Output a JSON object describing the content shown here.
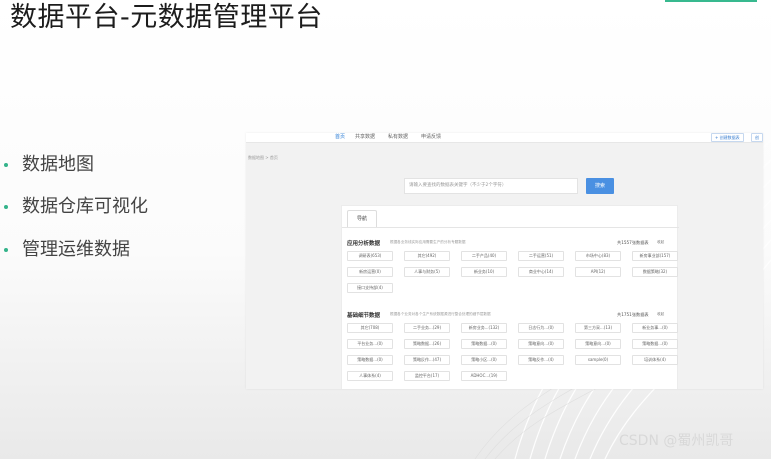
{
  "slide": {
    "title": "数据平台-元数据管理平台",
    "bullets": [
      "数据地图",
      "数据仓库可视化",
      "管理运维数据"
    ],
    "watermark": "CSDN @蜀州凯哥"
  },
  "screenshot": {
    "nav": {
      "links": [
        "首页",
        "共享数据",
        "私有数据",
        "申请反馈"
      ],
      "active_index": 0,
      "buttons": [
        "+ 创建数据表",
        "创"
      ]
    },
    "breadcrumb": "数据地图 > 首页",
    "search": {
      "placeholder": "请输入要查找的数据表关键字（不少于2个字符）",
      "button_label": "搜索"
    },
    "tab_label": "导航",
    "sections": [
      {
        "title": "应用分析数据",
        "description": "根据各业务线实际应用需要生产的分析专题数据",
        "count": "共1557张数据表",
        "toggle": "收起",
        "tags": [
          "调研表(653)",
          "其它(492)",
          "二手产品(40)",
          "二手运营(51)",
          "市场中心(83)",
          "新房事业部(157)",
          "新房运营(0)",
          "人事与财务(5)",
          "新业务(10)",
          "商业中心(14)",
          "API(12)",
          "数据策略(32)",
          "接口支持部(4)"
        ]
      },
      {
        "title": "基础细节数据",
        "description": "根据各个业务对各个生产系统数据源进行整合处理的细节层数据",
        "count": "共1751张数据表",
        "toggle": "收起",
        "tags": [
          "其它(708)",
          "二手业务...(29)",
          "新房业务...(132)",
          "日志行为...(0)",
          "第三方采...(13)",
          "新业务事...(0)",
          "平台业务...(0)",
          "策略数据...(26)",
          "策略数据...(0)",
          "策略意向...(0)",
          "策略意向...(0)",
          "策略数据...(0)",
          "策略数据...(0)",
          "策略反作...(47)",
          "策略小区...(0)",
          "策略反作...(4)",
          "sample(0)",
          "培训体系(4)",
          "人事体系(4)",
          "监控平台(17)",
          "ADHOC...(19)"
        ]
      }
    ]
  }
}
